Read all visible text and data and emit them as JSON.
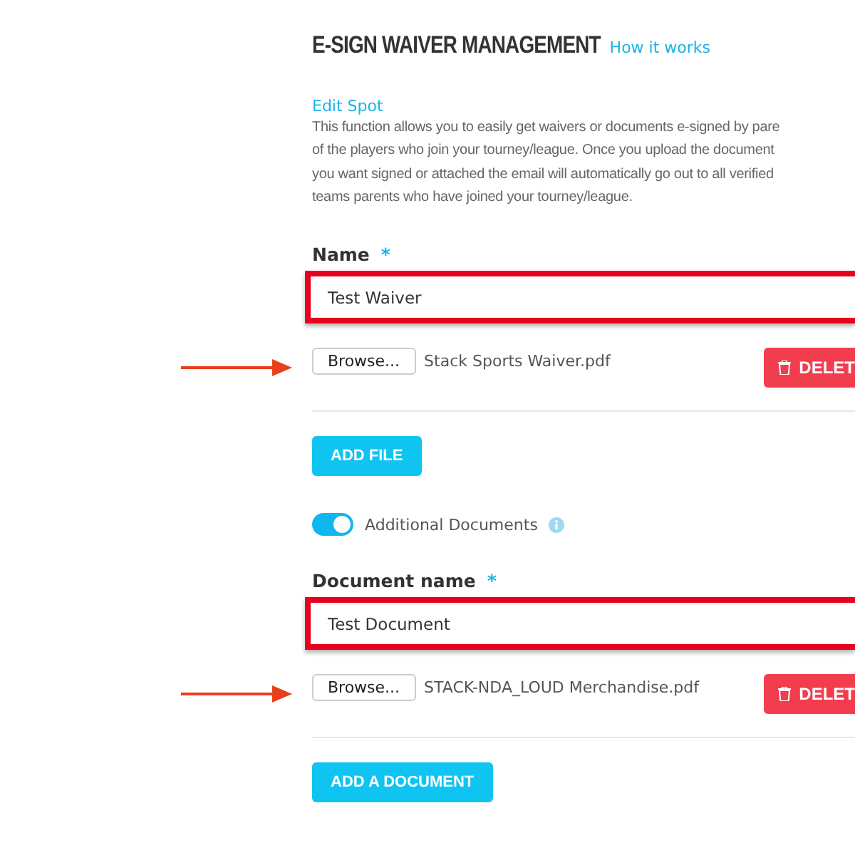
{
  "header": {
    "title": "E-SIGN WAIVER MANAGEMENT",
    "help_link": "How it works"
  },
  "edit_link": "Edit Spot",
  "description_lines": [
    "This function allows you to easily get waivers or documents e-signed by pare",
    "of the players who join your tourney/league. Once you upload the document",
    "you want signed or attached the email will automatically go out to all verified",
    "teams parents who have joined your tourney/league."
  ],
  "name_field": {
    "label": "Name",
    "required_mark": "*",
    "value": "Test Waiver",
    "highlighted": true
  },
  "waiver_file": {
    "browse": "Browse...",
    "file_name": "Stack Sports Waiver.pdf",
    "delete": "DELET",
    "arrow": true
  },
  "add_file_button": "ADD FILE",
  "additional_documents": {
    "label": "Additional Documents",
    "on": true
  },
  "document_field": {
    "label": "Document name",
    "required_mark": "*",
    "value": "Test Document",
    "highlighted": true
  },
  "document_file": {
    "browse": "Browse...",
    "file_name": "STACK-NDA_LOUD Merchandise.pdf",
    "delete": "DELET",
    "arrow": true
  },
  "add_document_button": "ADD A DOCUMENT"
}
